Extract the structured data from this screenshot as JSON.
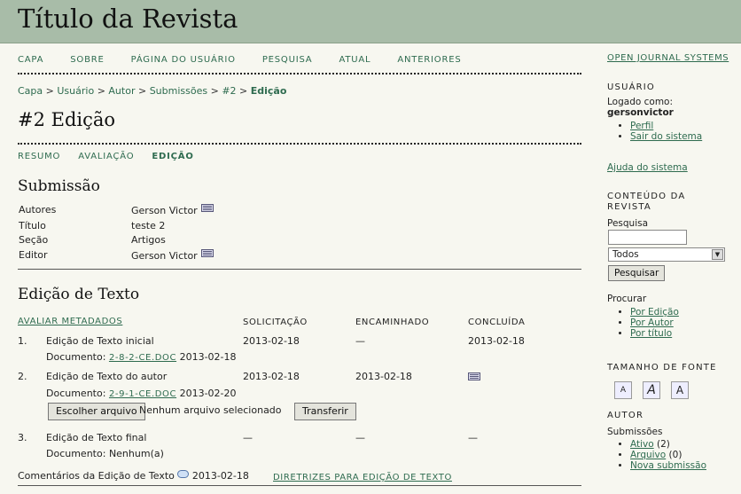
{
  "header": {
    "title": "Título da Revista"
  },
  "nav": [
    {
      "label": "CAPA"
    },
    {
      "label": "SOBRE"
    },
    {
      "label": "PÁGINA DO USUÁRIO"
    },
    {
      "label": "PESQUISA"
    },
    {
      "label": "ATUAL"
    },
    {
      "label": "ANTERIORES"
    }
  ],
  "breadcrumb": {
    "items": [
      "Capa",
      "Usuário",
      "Autor",
      "Submissões",
      "#2"
    ],
    "current": "Edição",
    "separator": ">"
  },
  "page_title": "#2 Edição",
  "subnav": [
    {
      "label": "RESUMO"
    },
    {
      "label": "AVALIAÇÃO"
    },
    {
      "label": "EDIÇÃO"
    }
  ],
  "submission": {
    "heading": "Submissão",
    "rows": [
      {
        "key": "Autores",
        "value": "Gerson Victor"
      },
      {
        "key": "Título",
        "value": "teste 2"
      },
      {
        "key": "Seção",
        "value": "Artigos"
      },
      {
        "key": "Editor",
        "value": "Gerson Victor"
      }
    ]
  },
  "copyedit": {
    "heading": "Edição de Texto",
    "review_metadata": "AVALIAR METADADOS",
    "columns": [
      "SOLICITAÇÃO",
      "ENCAMINHADO",
      "CONCLUÍDA"
    ],
    "steps": [
      {
        "num": "1.",
        "label": "Edição de Texto inicial",
        "request": "2013-02-18",
        "underway": "—",
        "complete": "2013-02-18",
        "doc_label": "Documento:",
        "doc_link": "2-8-2-CE.DOC",
        "doc_date": "2013-02-18"
      },
      {
        "num": "2.",
        "label": "Edição de Texto do autor",
        "request": "2013-02-18",
        "underway": "2013-02-18",
        "complete": "",
        "doc_label": "Documento:",
        "doc_link": "2-9-1-CE.DOC",
        "doc_date": "2013-02-20"
      },
      {
        "num": "3.",
        "label": "Edição de Texto final",
        "request": "—",
        "underway": "—",
        "complete": "—",
        "doc_label": "Documento:",
        "doc_value": "Nenhum(a)"
      }
    ],
    "file": {
      "choose_label": "Escolher arquivo",
      "status": "Nenhum arquivo selecionado",
      "upload_label": "Transferir"
    },
    "comments_label": "Comentários da Edição de Texto",
    "comments_date": "2013-02-18",
    "guidelines": "DIRETRIZES PARA EDIÇÃO DE TEXTO"
  },
  "sidebar": {
    "ojs": "OPEN JOURNAL SYSTEMS",
    "user": {
      "title": "USUÁRIO",
      "logged_as": "Logado como:",
      "username": "gersonvictor",
      "links": [
        "Perfil",
        "Sair do sistema"
      ]
    },
    "help": "Ajuda do sistema",
    "content": {
      "title": "CONTEÚDO DA REVISTA",
      "search_label": "Pesquisa",
      "search_value": "",
      "scope": "Todos",
      "search_button": "Pesquisar",
      "browse_label": "Procurar",
      "browse_links": [
        "Por Edição",
        "Por Autor",
        "Por título"
      ]
    },
    "font": {
      "title": "TAMANHO DE FONTE",
      "icons": [
        "font-smaller-icon",
        "font-default-icon",
        "font-larger-icon"
      ]
    },
    "author": {
      "title": "AUTOR",
      "submissions_label": "Submissões",
      "items": [
        {
          "link": "Ativo",
          "count": "(2)"
        },
        {
          "link": "Arquivo",
          "count": "(0)"
        },
        {
          "link": "Nova submissão",
          "count": ""
        }
      ]
    }
  }
}
